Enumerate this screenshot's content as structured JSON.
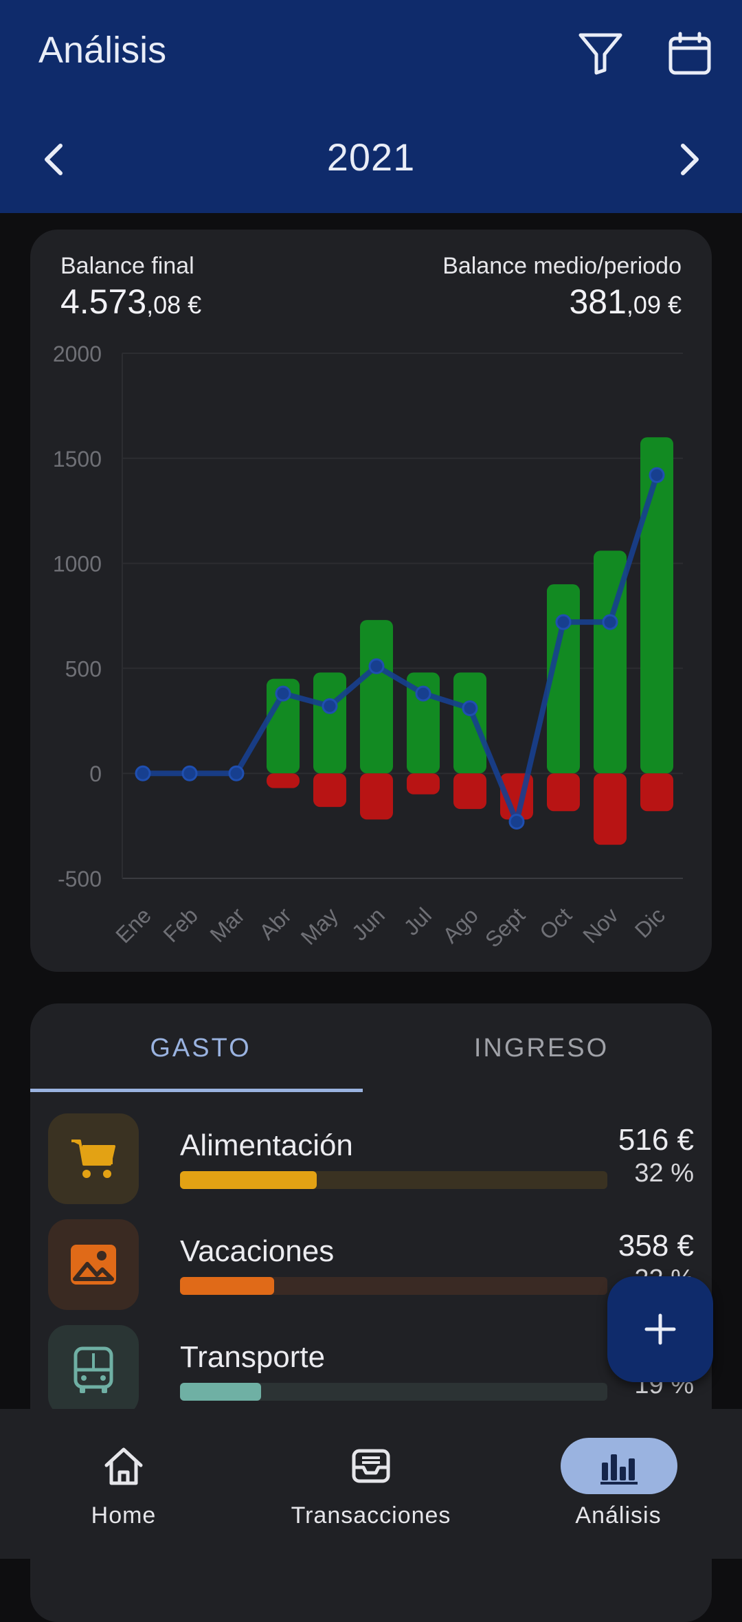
{
  "app": {
    "title": "Análisis",
    "icons": {
      "filter": "filter-icon",
      "calendar": "calendar-icon",
      "prev": "chevron-left-icon",
      "next": "chevron-right-icon"
    }
  },
  "period": {
    "year": "2021"
  },
  "summary": {
    "final_label": "Balance final",
    "final_int": "4.573",
    "final_dec": ",08 €",
    "avg_label": "Balance medio/periodo",
    "avg_int": "381",
    "avg_dec": ",09 €"
  },
  "chart_data": {
    "type": "bar",
    "categories": [
      "Ene",
      "Feb",
      "Mar",
      "Abr",
      "May",
      "Jun",
      "Jul",
      "Ago",
      "Sept",
      "Oct",
      "Nov",
      "Dic"
    ],
    "series": [
      {
        "values": [
          0,
          0,
          0,
          450,
          480,
          730,
          480,
          480,
          0,
          900,
          1060,
          1600
        ]
      },
      {
        "values": [
          0,
          0,
          0,
          -70,
          -160,
          -220,
          -100,
          -170,
          -220,
          -180,
          -340,
          -180
        ]
      },
      {
        "type": "line",
        "values": [
          0,
          0,
          0,
          380,
          320,
          510,
          380,
          310,
          -230,
          720,
          720,
          1420
        ]
      }
    ],
    "ylim": [
      -500,
      2000
    ],
    "yticks": [
      2000,
      1500,
      1000,
      500,
      0,
      -500
    ],
    "grid": true,
    "colors": {
      "income": "#128a22",
      "expense": "#b81414",
      "balance": "#173f8f"
    }
  },
  "tabs": [
    {
      "label": "GASTO",
      "active": true
    },
    {
      "label": "INGRESO",
      "active": false
    }
  ],
  "categories": [
    {
      "name": "Alimentación",
      "amount": "516 €",
      "percent": "32 %",
      "fraction": 0.32,
      "icon": "cart-icon",
      "color": "#e3a214",
      "icon_bg": "#3a3222",
      "track": "#3a3222"
    },
    {
      "name": "Vacaciones",
      "amount": "358 €",
      "percent": "22 %",
      "fraction": 0.22,
      "icon": "image-icon",
      "color": "#e06a18",
      "icon_bg": "#3a2a22",
      "track": "#3a2a24"
    },
    {
      "name": "Transporte",
      "amount": "",
      "percent": "19 %",
      "fraction": 0.19,
      "icon": "bus-icon",
      "color": "#6fb0a4",
      "icon_bg": "#2a3534",
      "track": "#2c3334"
    }
  ],
  "fab": {
    "icon": "plus-icon"
  },
  "nav": [
    {
      "label": "Home",
      "icon": "home-icon",
      "active": false
    },
    {
      "label": "Transacciones",
      "icon": "inbox-icon",
      "active": false
    },
    {
      "label": "Análisis",
      "icon": "bar-chart-icon",
      "active": true
    }
  ],
  "colors": {
    "header": "#0f2b6b",
    "accent": "#9ab3e0",
    "card": "#202125"
  }
}
